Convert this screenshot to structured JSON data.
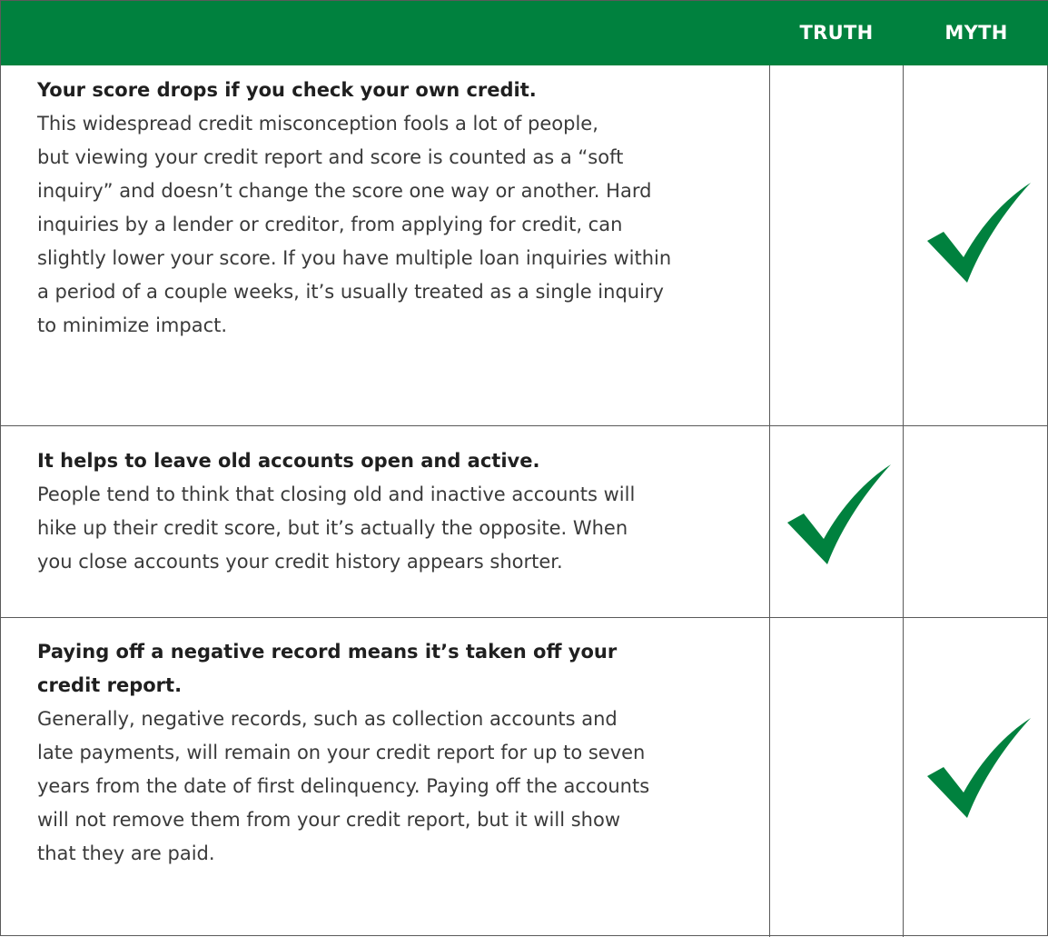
{
  "header": {
    "truth_label": "TRUTH",
    "myth_label": "MYTH",
    "background": "#00813e",
    "text_color": "#ffffff"
  },
  "check_color": "#00813e",
  "rows": [
    {
      "question_lines": [
        "Your score drops if you check your own credit."
      ],
      "answer_lines": [
        "This widespread credit misconception fools a lot of people,",
        "but viewing your credit report and score is counted as a “soft",
        "inquiry” and doesn’t change the score one way or another. Hard",
        "inquiries by a lender or creditor, from applying for credit, can",
        "slightly lower your score. If you have multiple loan inquiries within",
        "a period of a couple weeks, it’s usually treated as a single inquiry",
        "to minimize impact."
      ],
      "verdict": "myth"
    },
    {
      "question_lines": [
        "It helps to leave old accounts open and active."
      ],
      "answer_lines": [
        "People tend to think that closing old and inactive accounts will",
        "hike up their credit score, but it’s actually the opposite. When",
        "you close accounts your credit history appears shorter."
      ],
      "verdict": "truth"
    },
    {
      "question_lines": [
        "Paying off a negative record means it’s taken off your",
        "credit report."
      ],
      "answer_lines": [
        "Generally, negative records, such as collection accounts and",
        "late payments, will remain on your credit report for up to seven",
        "years from the date of first delinquency. Paying off the accounts",
        "will not remove them from your credit report, but it will show",
        "that they are paid."
      ],
      "verdict": "myth"
    }
  ]
}
